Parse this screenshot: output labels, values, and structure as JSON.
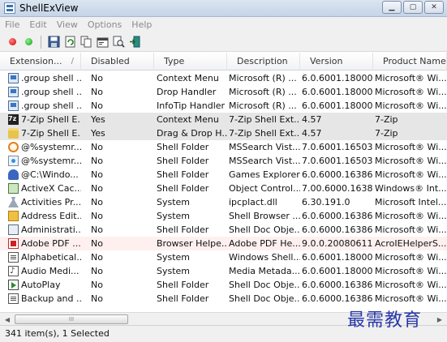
{
  "window": {
    "title": "ShellExView"
  },
  "menu": [
    "File",
    "Edit",
    "View",
    "Options",
    "Help"
  ],
  "toolbar": [
    "disable-icon",
    "enable-icon",
    "save-icon",
    "refresh-icon",
    "copy-icon",
    "properties-icon",
    "find-icon",
    "exit-icon"
  ],
  "columns": [
    "Extension...",
    "Disabled",
    "Type",
    "Description",
    "Version",
    "Product Name"
  ],
  "rows": [
    {
      "icon": "pc",
      "ext": ".group shell ...",
      "disabled": "No",
      "type": "Context Menu",
      "desc": "Microsoft (R) ...",
      "version": "6.0.6001.18000 ...",
      "product": "Microsoft® Wi...",
      "style": ""
    },
    {
      "icon": "pc",
      "ext": ".group shell ...",
      "disabled": "No",
      "type": "Drop Handler",
      "desc": "Microsoft (R) ...",
      "version": "6.0.6001.18000 ...",
      "product": "Microsoft® Wi...",
      "style": ""
    },
    {
      "icon": "pc",
      "ext": ".group shell ...",
      "disabled": "No",
      "type": "InfoTip Handler",
      "desc": "Microsoft (R) ...",
      "version": "6.0.6001.18000 ...",
      "product": "Microsoft® Wi...",
      "style": ""
    },
    {
      "icon": "zip",
      "ext": "7-Zip Shell E...",
      "disabled": "Yes",
      "type": "Context Menu",
      "desc": "7-Zip Shell Ext...",
      "version": "4.57",
      "product": "7-Zip",
      "style": "sel"
    },
    {
      "icon": "folder",
      "ext": "7-Zip Shell E...",
      "disabled": "Yes",
      "type": "Drag & Drop H...",
      "desc": "7-Zip Shell Ext...",
      "version": "4.57",
      "product": "7-Zip",
      "style": "sel"
    },
    {
      "icon": "search",
      "ext": "@%systemr...",
      "disabled": "No",
      "type": "Shell Folder",
      "desc": "MSSearch Vist...",
      "version": "7.0.6001.16503 ...",
      "product": "Microsoft® Wi...",
      "style": ""
    },
    {
      "icon": "ie",
      "ext": "@%systemr...",
      "disabled": "No",
      "type": "Shell Folder",
      "desc": "MSSearch Vist...",
      "version": "7.0.6001.16503 ...",
      "product": "Microsoft® Wi...",
      "style": ""
    },
    {
      "icon": "trophy",
      "ext": "@C:\\Windo...",
      "disabled": "No",
      "type": "Shell Folder",
      "desc": "Games Explorer",
      "version": "6.0.6000.16386 ...",
      "product": "Microsoft® Wi...",
      "style": ""
    },
    {
      "icon": "activex",
      "ext": "ActiveX Cac...",
      "disabled": "No",
      "type": "Shell Folder",
      "desc": "Object Control...",
      "version": "7.00.6000.1638...",
      "product": "Windows® Int...",
      "style": ""
    },
    {
      "icon": "tools",
      "ext": "Activities Pr...",
      "disabled": "No",
      "type": "System",
      "desc": "ipcplact.dll",
      "version": "6.30.191.0",
      "product": "Microsoft Intel...",
      "style": ""
    },
    {
      "icon": "addr",
      "ext": "Address Edit...",
      "disabled": "No",
      "type": "System",
      "desc": "Shell Browser ...",
      "version": "6.0.6000.16386 ...",
      "product": "Microsoft® Wi...",
      "style": ""
    },
    {
      "icon": "admin",
      "ext": "Administrati...",
      "disabled": "No",
      "type": "Shell Folder",
      "desc": "Shell Doc Obje...",
      "version": "6.0.6000.16386 ...",
      "product": "Microsoft® Wi...",
      "style": ""
    },
    {
      "icon": "pdf",
      "ext": "Adobe PDF ...",
      "disabled": "No",
      "type": "Browser Helpe...",
      "desc": "Adobe PDF He...",
      "version": "9.0.0.2008061100",
      "product": "AcroIEHelperS...",
      "style": "pink"
    },
    {
      "icon": "doc",
      "ext": "Alphabetical...",
      "disabled": "No",
      "type": "System",
      "desc": "Windows Shell...",
      "version": "6.0.6001.18000 ...",
      "product": "Microsoft® Wi...",
      "style": ""
    },
    {
      "icon": "audio",
      "ext": "Audio Medi...",
      "disabled": "No",
      "type": "System",
      "desc": "Media Metada...",
      "version": "6.0.6001.18000 ...",
      "product": "Microsoft® Wi...",
      "style": ""
    },
    {
      "icon": "play",
      "ext": "AutoPlay",
      "disabled": "No",
      "type": "Shell Folder",
      "desc": "Shell Doc Obje...",
      "version": "6.0.6000.16386 ...",
      "product": "Microsoft® Wi...",
      "style": ""
    },
    {
      "icon": "doc",
      "ext": "Backup and ...",
      "disabled": "No",
      "type": "Shell Folder",
      "desc": "Shell Doc Obje...",
      "version": "6.0.6000.16386 ...",
      "product": "Microsoft® Wi...",
      "style": ""
    }
  ],
  "scroll": {
    "thumb_label": "III"
  },
  "status": {
    "text": "341 item(s), 1 Selected"
  },
  "watermark": "最需教育"
}
